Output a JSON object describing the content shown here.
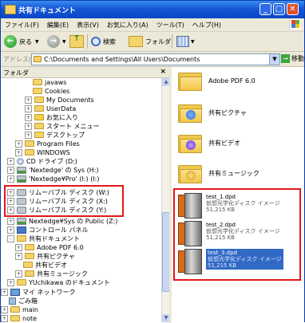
{
  "window": {
    "title": "共有ドキュメント"
  },
  "titlebar": {
    "minimize": "_",
    "maximize": "□",
    "close": "✕"
  },
  "menu": [
    "ファイル(F)",
    "編集(E)",
    "表示(V)",
    "お気に入り(A)",
    "ツール(T)",
    "ヘルプ(H)"
  ],
  "toolbar": {
    "back_label": "戻る",
    "search_label": "検索",
    "folders_label": "フォルダ"
  },
  "address": {
    "label": "アドレス(D)",
    "value": "C:\\Documents and Settings\\All Users\\Documents",
    "go_label": "移動"
  },
  "folder_pane": {
    "title": "フォルダ",
    "close": "×"
  },
  "tree": [
    {
      "label": "javaws",
      "exp": ""
    },
    {
      "label": "Cookies",
      "exp": ""
    },
    {
      "label": "My Documents",
      "exp": "+"
    },
    {
      "label": "UserData",
      "exp": "+"
    },
    {
      "label": "お気に入り",
      "exp": "+"
    },
    {
      "label": "スタート メニュー",
      "exp": "+"
    },
    {
      "label": "デスクトップ",
      "exp": "+"
    },
    {
      "label": "Program Files",
      "exp": "+"
    },
    {
      "label": "WINDOWS",
      "exp": "+"
    },
    {
      "label": "CD ドライブ (D:)",
      "exp": "+"
    },
    {
      "label": "'Nextedge' の Sys (H:)",
      "exp": "+"
    },
    {
      "label": "'Nextedge¥Pro' (I:) (I:)",
      "exp": "+"
    },
    {
      "label": "リムーバブル ディスク (W:)",
      "exp": "+"
    },
    {
      "label": "リムーバブル ディスク (X:)",
      "exp": "+"
    },
    {
      "label": "リムーバブル ディスク (Y:)",
      "exp": "+"
    },
    {
      "label": "Nextedge¥Sys の Public (Z:)",
      "exp": "+"
    },
    {
      "label": "コントロール パネル",
      "exp": "+"
    },
    {
      "label": "共有ドキュメント",
      "exp": "-"
    },
    {
      "label": "Adobe PDF 6.0",
      "exp": "+"
    },
    {
      "label": "共有ピクチャ",
      "exp": "+"
    },
    {
      "label": "共有ビデオ",
      "exp": ""
    },
    {
      "label": "共有ミュージック",
      "exp": "+"
    },
    {
      "label": "YUchikawa のドキュメント",
      "exp": "+"
    },
    {
      "label": "マイ ネットワーク",
      "exp": "+"
    },
    {
      "label": "ごみ箱",
      "exp": ""
    },
    {
      "label": "main",
      "exp": "+"
    },
    {
      "label": "note",
      "exp": "+"
    }
  ],
  "content": {
    "folders": [
      "Adobe PDF 6.0",
      "共有ピクチャ",
      "共有ビデオ",
      "共有ミュージック"
    ],
    "files": [
      {
        "name": "test_1.dpd",
        "type": "仮想光学化ディスク イメージ",
        "size": "51,215 KB",
        "selected": false
      },
      {
        "name": "test_2.dpd",
        "type": "仮想光学化ディスク イメージ",
        "size": "51,215 KB",
        "selected": false
      },
      {
        "name": "test_3.dpd",
        "type": "仮想光学化ディスク イメージ",
        "size": "51,215 KB",
        "selected": true
      }
    ]
  },
  "colors": {
    "highlight_box": "#e21818",
    "selection": "#316ac5",
    "titlebar": "#0a46c8"
  }
}
